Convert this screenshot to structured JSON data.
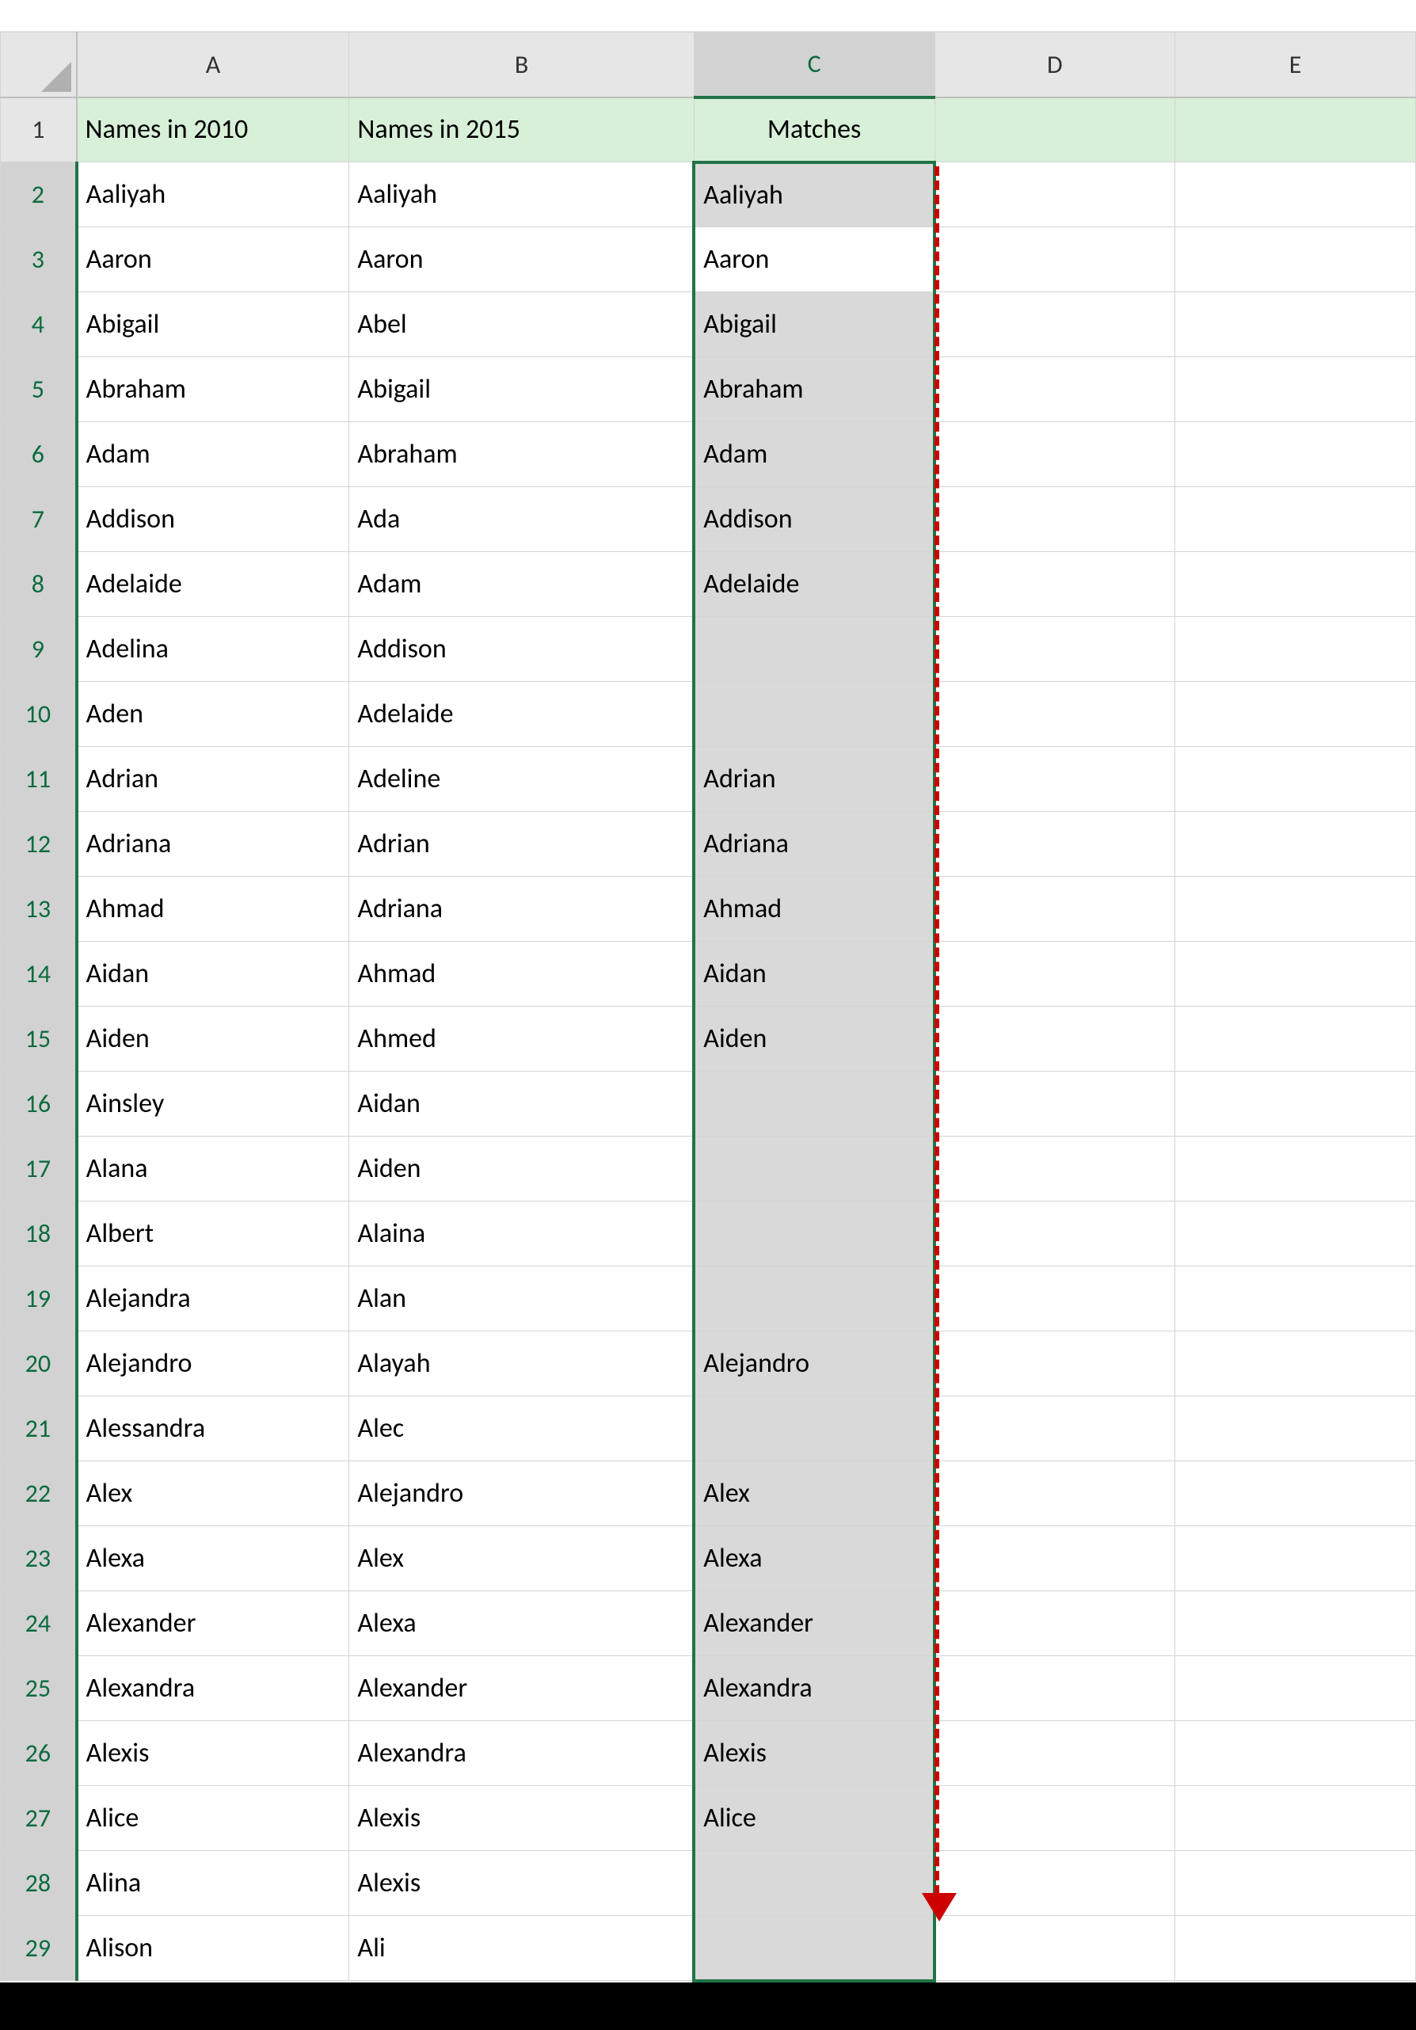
{
  "columns": [
    "A",
    "B",
    "C",
    "D",
    "E"
  ],
  "selected_column": "C",
  "selection_range": "C2:C29",
  "header_row": {
    "a": "Names in 2010",
    "b": "Names in 2015",
    "c": "Matches"
  },
  "rows": [
    {
      "n": 1
    },
    {
      "n": 2,
      "a": "Aaliyah",
      "b": "Aaliyah",
      "c": "Aaliyah",
      "ff": true,
      "sel": "first"
    },
    {
      "n": 3,
      "a": "Aaron",
      "b": "Aaron",
      "c": "Aaron",
      "ff": false,
      "sel": "mid"
    },
    {
      "n": 4,
      "a": "Abigail",
      "b": "Abel",
      "c": "Abigail",
      "ff": true,
      "sel": "mid"
    },
    {
      "n": 5,
      "a": "Abraham",
      "b": "Abigail",
      "c": "Abraham",
      "ff": true,
      "sel": "mid"
    },
    {
      "n": 6,
      "a": "Adam",
      "b": "Abraham",
      "c": "Adam",
      "ff": true,
      "sel": "mid"
    },
    {
      "n": 7,
      "a": "Addison",
      "b": "Ada",
      "c": "Addison",
      "ff": true,
      "sel": "mid"
    },
    {
      "n": 8,
      "a": "Adelaide",
      "b": "Adam",
      "c": "Adelaide",
      "ff": true,
      "sel": "mid"
    },
    {
      "n": 9,
      "a": "Adelina",
      "b": "Addison",
      "c": "",
      "ff": true,
      "sel": "mid"
    },
    {
      "n": 10,
      "a": "Aden",
      "b": "Adelaide",
      "c": "",
      "ff": true,
      "sel": "mid"
    },
    {
      "n": 11,
      "a": "Adrian",
      "b": "Adeline",
      "c": "Adrian",
      "ff": true,
      "sel": "mid"
    },
    {
      "n": 12,
      "a": "Adriana",
      "b": "Adrian",
      "c": "Adriana",
      "ff": true,
      "sel": "mid"
    },
    {
      "n": 13,
      "a": "Ahmad",
      "b": "Adriana",
      "c": "Ahmad",
      "ff": true,
      "sel": "mid"
    },
    {
      "n": 14,
      "a": "Aidan",
      "b": "Ahmad",
      "c": "Aidan",
      "ff": true,
      "sel": "mid"
    },
    {
      "n": 15,
      "a": "Aiden",
      "b": "Ahmed",
      "c": "Aiden",
      "ff": true,
      "sel": "mid"
    },
    {
      "n": 16,
      "a": "Ainsley",
      "b": "Aidan",
      "c": "",
      "ff": true,
      "sel": "mid"
    },
    {
      "n": 17,
      "a": "Alana",
      "b": "Aiden",
      "c": "",
      "ff": true,
      "sel": "mid"
    },
    {
      "n": 18,
      "a": "Albert",
      "b": "Alaina",
      "c": "",
      "ff": true,
      "sel": "mid"
    },
    {
      "n": 19,
      "a": "Alejandra",
      "b": "Alan",
      "c": "",
      "ff": true,
      "sel": "mid"
    },
    {
      "n": 20,
      "a": "Alejandro",
      "b": "Alayah",
      "c": "Alejandro",
      "ff": true,
      "sel": "mid"
    },
    {
      "n": 21,
      "a": "Alessandra",
      "b": "Alec",
      "c": "",
      "ff": true,
      "sel": "mid"
    },
    {
      "n": 22,
      "a": "Alex",
      "b": "Alejandro",
      "c": "Alex",
      "ff": true,
      "sel": "mid"
    },
    {
      "n": 23,
      "a": "Alexa",
      "b": "Alex",
      "c": "Alexa",
      "ff": true,
      "sel": "mid"
    },
    {
      "n": 24,
      "a": "Alexander",
      "b": "Alexa",
      "c": "Alexander",
      "ff": true,
      "sel": "mid"
    },
    {
      "n": 25,
      "a": "Alexandra",
      "b": "Alexander",
      "c": "Alexandra",
      "ff": true,
      "sel": "mid"
    },
    {
      "n": 26,
      "a": "Alexis",
      "b": "Alexandra",
      "c": "Alexis",
      "ff": true,
      "sel": "mid"
    },
    {
      "n": 27,
      "a": "Alice",
      "b": "Alexis",
      "c": "Alice",
      "ff": true,
      "sel": "mid"
    },
    {
      "n": 28,
      "a": "Alina",
      "b": "Alexis",
      "c": "",
      "ff": true,
      "sel": "mid"
    },
    {
      "n": 29,
      "a": "Alison",
      "b": "Ali",
      "c": "",
      "ff": true,
      "sel": "last"
    }
  ],
  "flash_fill_icon": {
    "bolt": "⚡",
    "grid": "▦"
  }
}
